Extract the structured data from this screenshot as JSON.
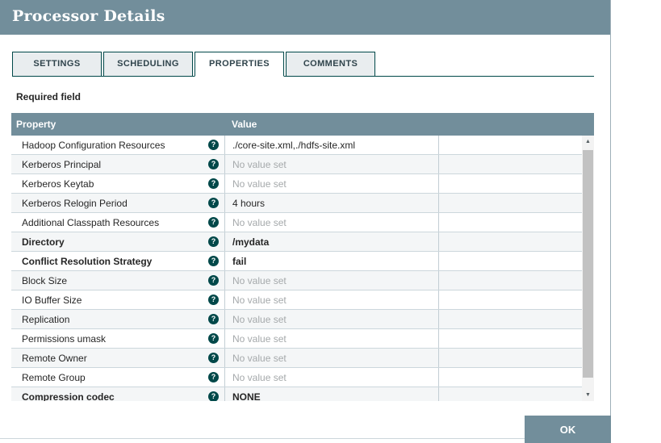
{
  "window": {
    "title": "Processor Details"
  },
  "tabs": [
    {
      "label": "SETTINGS",
      "active": false
    },
    {
      "label": "SCHEDULING",
      "active": false
    },
    {
      "label": "PROPERTIES",
      "active": true
    },
    {
      "label": "COMMENTS",
      "active": false
    }
  ],
  "required_field_label": "Required field",
  "properties_table": {
    "columns": {
      "property": "Property",
      "value": "Value"
    },
    "rows": [
      {
        "property": "Hadoop Configuration Resources",
        "value": "./core-site.xml,./hdfs-site.xml",
        "required": false,
        "unset": false
      },
      {
        "property": "Kerberos Principal",
        "value": "No value set",
        "required": false,
        "unset": true
      },
      {
        "property": "Kerberos Keytab",
        "value": "No value set",
        "required": false,
        "unset": true
      },
      {
        "property": "Kerberos Relogin Period",
        "value": "4 hours",
        "required": false,
        "unset": false
      },
      {
        "property": "Additional Classpath Resources",
        "value": "No value set",
        "required": false,
        "unset": true
      },
      {
        "property": "Directory",
        "value": "/mydata",
        "required": true,
        "unset": false
      },
      {
        "property": "Conflict Resolution Strategy",
        "value": "fail",
        "required": true,
        "unset": false
      },
      {
        "property": "Block Size",
        "value": "No value set",
        "required": false,
        "unset": true
      },
      {
        "property": "IO Buffer Size",
        "value": "No value set",
        "required": false,
        "unset": true
      },
      {
        "property": "Replication",
        "value": "No value set",
        "required": false,
        "unset": true
      },
      {
        "property": "Permissions umask",
        "value": "No value set",
        "required": false,
        "unset": true
      },
      {
        "property": "Remote Owner",
        "value": "No value set",
        "required": false,
        "unset": true
      },
      {
        "property": "Remote Group",
        "value": "No value set",
        "required": false,
        "unset": true
      },
      {
        "property": "Compression codec",
        "value": "NONE",
        "required": true,
        "unset": false
      }
    ]
  },
  "icons": {
    "help": "?",
    "scroll_up": "▲",
    "scroll_down": "▼"
  },
  "ok_button_label": "OK",
  "colors": {
    "header_slate": "#728e9b",
    "accent_teal": "#004849",
    "row_alt": "#f4f6f7",
    "row_border": "#ccd7dc",
    "text_dark": "#262626",
    "text_unset": "#a5a9ab",
    "tab_inactive_bg": "#e9edef"
  }
}
